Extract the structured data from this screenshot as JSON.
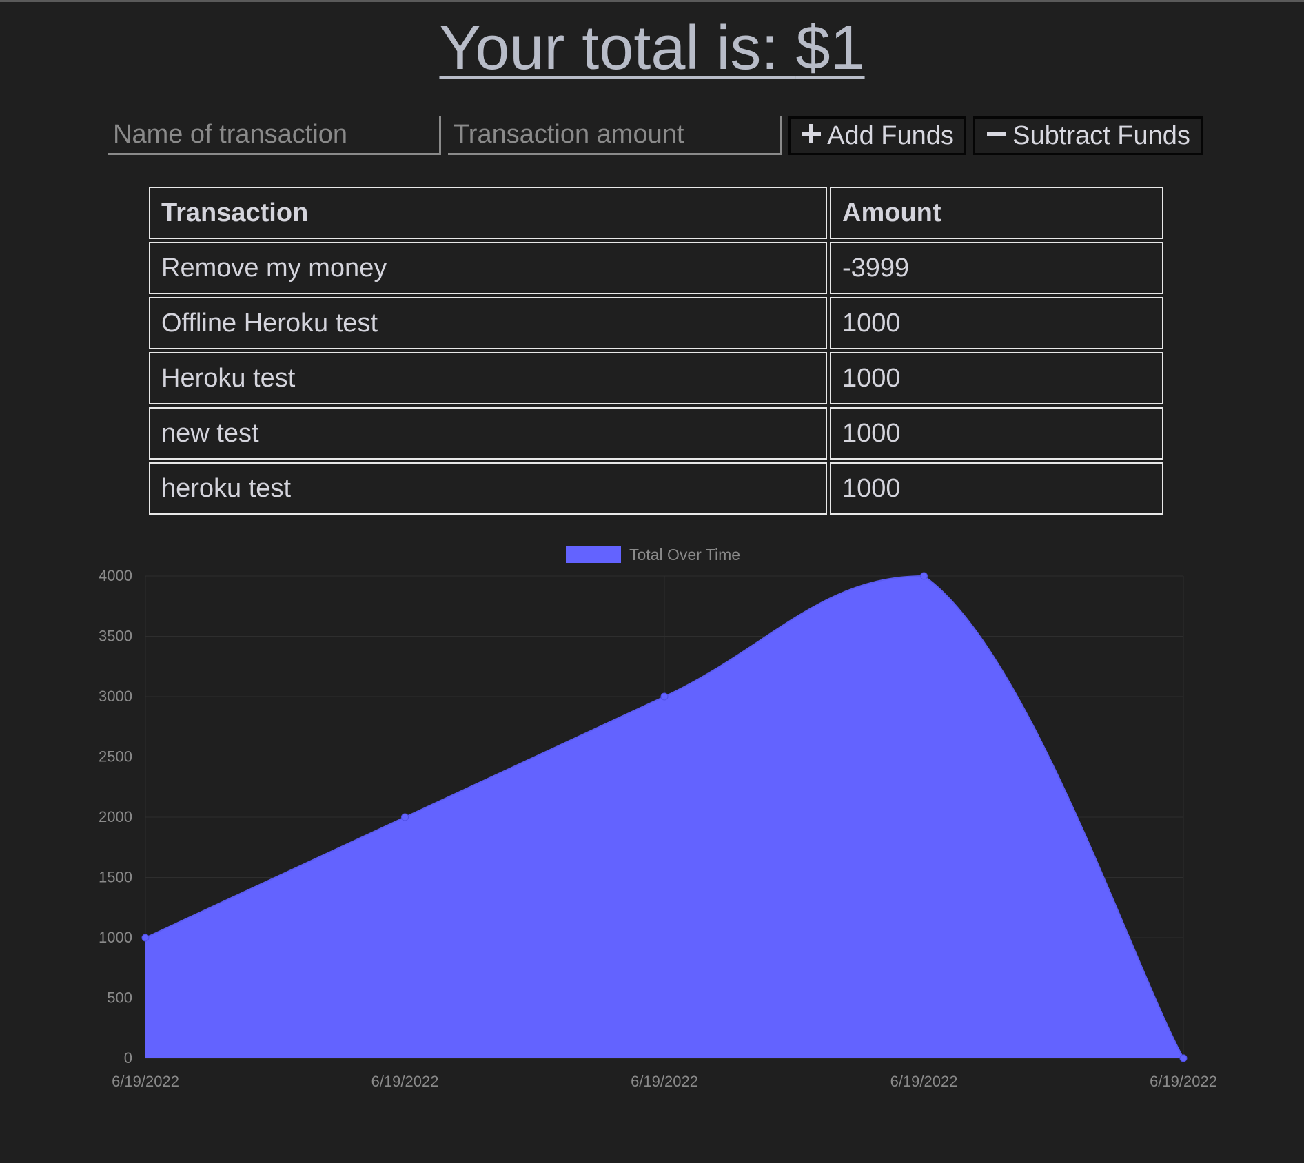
{
  "header": {
    "total_prefix": "Your total is: ",
    "total_value": "$1"
  },
  "form": {
    "name_placeholder": "Name of transaction",
    "amount_placeholder": "Transaction amount",
    "add_label": "Add Funds",
    "subtract_label": "Subtract Funds",
    "add_icon": "plus-icon",
    "subtract_icon": "minus-icon"
  },
  "table": {
    "headers": [
      "Transaction",
      "Amount"
    ],
    "rows": [
      {
        "name": "Remove my money",
        "amount": "-3999"
      },
      {
        "name": "Offline Heroku test",
        "amount": "1000"
      },
      {
        "name": "Heroku test",
        "amount": "1000"
      },
      {
        "name": "new test",
        "amount": "1000"
      },
      {
        "name": "heroku test",
        "amount": "1000"
      }
    ]
  },
  "colors": {
    "background": "#1f1f1f",
    "accent": "#6363ff",
    "grid": "#2e2e2e",
    "tick_text": "#8a8a8a"
  },
  "chart_data": {
    "type": "area",
    "legend": "Total Over Time",
    "legend_position": "top-center",
    "x": [
      "6/19/2022",
      "6/19/2022",
      "6/19/2022",
      "6/19/2022",
      "6/19/2022"
    ],
    "series": [
      {
        "name": "Total Over Time",
        "values": [
          1000,
          2000,
          3000,
          4000,
          1
        ]
      }
    ],
    "ylim": [
      0,
      4000
    ],
    "yticks": [
      0,
      500,
      1000,
      1500,
      2000,
      2500,
      3000,
      3500,
      4000
    ],
    "grid": true,
    "smooth": true
  }
}
